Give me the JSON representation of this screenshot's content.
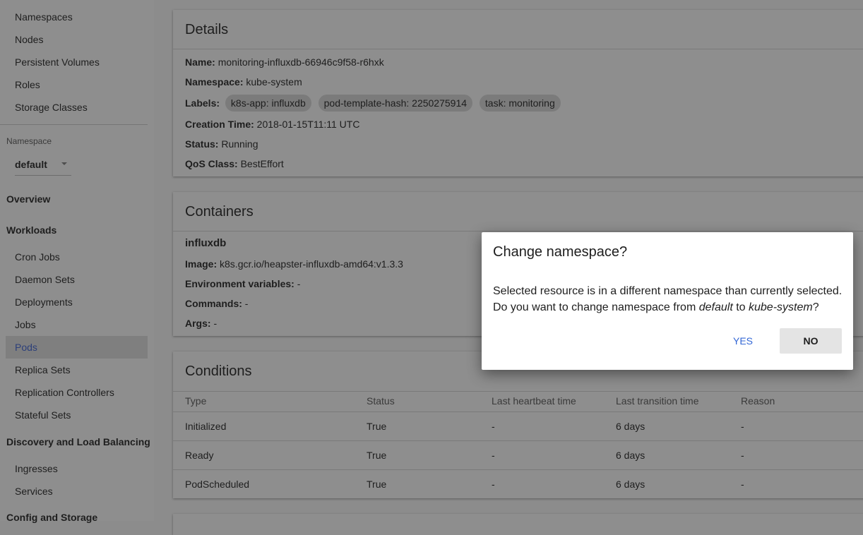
{
  "sidebar": {
    "cluster_items": [
      "Namespaces",
      "Nodes",
      "Persistent Volumes",
      "Roles",
      "Storage Classes"
    ],
    "namespace": {
      "label": "Namespace",
      "value": "default"
    },
    "overview": "Overview",
    "workloads": "Workloads",
    "workload_items": [
      "Cron Jobs",
      "Daemon Sets",
      "Deployments",
      "Jobs",
      "Pods",
      "Replica Sets",
      "Replication Controllers",
      "Stateful Sets"
    ],
    "selected_item": "Pods",
    "discovery": "Discovery and Load Balancing",
    "discovery_items": [
      "Ingresses",
      "Services"
    ],
    "config": "Config and Storage"
  },
  "details": {
    "title": "Details",
    "name_label": "Name:",
    "name": "monitoring-influxdb-66946c9f58-r6hxk",
    "namespace_label": "Namespace:",
    "namespace": "kube-system",
    "labels_label": "Labels:",
    "labels": [
      "k8s-app: influxdb",
      "pod-template-hash: 2250275914",
      "task: monitoring"
    ],
    "creation_label": "Creation Time:",
    "creation": "2018-01-15T11:11 UTC",
    "status_label": "Status:",
    "status": "Running",
    "qos_label": "QoS Class:",
    "qos": "BestEffort"
  },
  "containers": {
    "title": "Containers",
    "name": "influxdb",
    "image_label": "Image:",
    "image": "k8s.gcr.io/heapster-influxdb-amd64:v1.3.3",
    "env_label": "Environment variables:",
    "env": "-",
    "commands_label": "Commands:",
    "commands": "-",
    "args_label": "Args:",
    "args": "-"
  },
  "conditions": {
    "title": "Conditions",
    "columns": [
      "Type",
      "Status",
      "Last heartbeat time",
      "Last transition time",
      "Reason"
    ],
    "rows": [
      [
        "Initialized",
        "True",
        "-",
        "6 days",
        "-"
      ],
      [
        "Ready",
        "True",
        "-",
        "6 days",
        "-"
      ],
      [
        "PodScheduled",
        "True",
        "-",
        "6 days",
        "-"
      ]
    ]
  },
  "dialog": {
    "title": "Change namespace?",
    "line1": "Selected resource is in a different namespace than currently selected.",
    "line2_prefix": "Do you want to change namespace from ",
    "from_ns": "default",
    "line2_mid": " to ",
    "to_ns": "kube-system",
    "line2_suffix": "?",
    "yes_label": "YES",
    "no_label": "NO"
  },
  "colors": {
    "link_blue": "#3367d6",
    "overlay": "#8c8c8c",
    "dialog_bg": "#ffffff"
  }
}
